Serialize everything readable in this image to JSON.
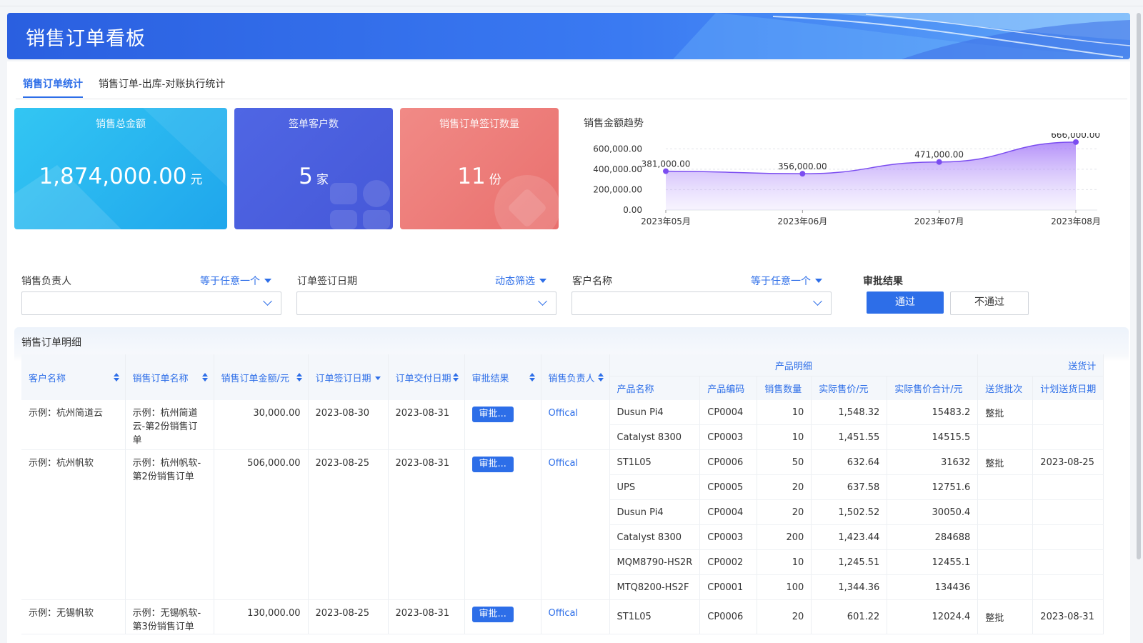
{
  "header": {
    "title": "销售订单看板"
  },
  "tabs": [
    {
      "label": "销售订单统计",
      "active": true
    },
    {
      "label": "销售订单-出库-对账执行统计",
      "active": false
    }
  ],
  "kpis": [
    {
      "label": "销售总金额",
      "value": "1,874,000.00",
      "unit": "元",
      "color": "#2bb6f0"
    },
    {
      "label": "签单客户数",
      "value": "5",
      "unit": "家",
      "color": "#4b5fe0"
    },
    {
      "label": "销售订单签订数量",
      "value": "11",
      "unit": "份",
      "color": "#ef7b78"
    }
  ],
  "chart_title": "销售金额趋势",
  "chart_data": {
    "type": "area",
    "categories": [
      "2023年05月",
      "2023年06月",
      "2023年07月",
      "2023年08月"
    ],
    "values": [
      381000,
      356000,
      471000,
      666000
    ],
    "value_labels": [
      "381,000.00",
      "356,000.00",
      "471,000.00",
      "666,000.00"
    ],
    "y_ticks": [
      "0.00",
      "200,000.00",
      "400,000.00",
      "600,000.00"
    ],
    "y_tick_values": [
      0,
      200000,
      400000,
      600000
    ],
    "ylim": [
      0,
      700000
    ],
    "grid": true,
    "color": "#7b4df0"
  },
  "filters": [
    {
      "label": "销售负责人",
      "mode": "等于任意一个"
    },
    {
      "label": "订单签订日期",
      "mode": "动态筛选"
    },
    {
      "label": "客户名称",
      "mode": "等于任意一个"
    }
  ],
  "approval": {
    "label": "审批结果",
    "pass": "通过",
    "fail": "不通过"
  },
  "detail": {
    "title": "销售订单明细",
    "group_product": "产品明细",
    "group_delivery": "送货计",
    "columns": [
      "客户名称",
      "销售订单名称",
      "销售订单金额/元",
      "订单签订日期",
      "订单交付日期",
      "审批结果",
      "销售负责人",
      "产品名称",
      "产品编码",
      "销售数量",
      "实际售价/元",
      "实际售价合计/元",
      "送货批次",
      "计划送货日期"
    ],
    "orders": [
      {
        "customer": "示例：杭州简道云",
        "order": "示例：杭州简道云-第2份销售订单",
        "amount": "30,000.00",
        "sign": "2023-08-30",
        "deliver": "2023-08-31",
        "approval": "审批...",
        "owner": "Offical",
        "products": [
          {
            "name": "Dusun Pi4",
            "code": "CP0004",
            "qty": "10",
            "price": "1,548.32",
            "total": "15483.2",
            "batch": "整批",
            "plan": ""
          },
          {
            "name": "Catalyst 8300",
            "code": "CP0003",
            "qty": "10",
            "price": "1,451.55",
            "total": "14515.5",
            "batch": "",
            "plan": ""
          }
        ]
      },
      {
        "customer": "示例：杭州帆软",
        "order": "示例：杭州帆软-第2份销售订单",
        "amount": "506,000.00",
        "sign": "2023-08-25",
        "deliver": "2023-08-31",
        "approval": "审批...",
        "owner": "Offical",
        "products": [
          {
            "name": "ST1L05",
            "code": "CP0006",
            "qty": "50",
            "price": "632.64",
            "total": "31632",
            "batch": "整批",
            "plan": "2023-08-25"
          },
          {
            "name": "UPS",
            "code": "CP0005",
            "qty": "20",
            "price": "637.58",
            "total": "12751.6",
            "batch": "",
            "plan": ""
          },
          {
            "name": "Dusun Pi4",
            "code": "CP0004",
            "qty": "20",
            "price": "1,502.52",
            "total": "30050.4",
            "batch": "",
            "plan": ""
          },
          {
            "name": "Catalyst 8300",
            "code": "CP0003",
            "qty": "200",
            "price": "1,423.44",
            "total": "284688",
            "batch": "",
            "plan": ""
          },
          {
            "name": "MQM8790-HS2R",
            "code": "CP0002",
            "qty": "10",
            "price": "1,245.51",
            "total": "12455.1",
            "batch": "",
            "plan": ""
          },
          {
            "name": "MTQ8200-HS2F",
            "code": "CP0001",
            "qty": "100",
            "price": "1,344.36",
            "total": "134436",
            "batch": "",
            "plan": ""
          }
        ]
      },
      {
        "customer": "示例：无锡帆软",
        "order": "示例：无锡帆软-第3份销售订单",
        "amount": "130,000.00",
        "sign": "2023-08-25",
        "deliver": "2023-08-31",
        "approval": "审批...",
        "owner": "Offical",
        "products": [
          {
            "name": "ST1L05",
            "code": "CP0006",
            "qty": "20",
            "price": "601.22",
            "total": "12024.4",
            "batch": "整批",
            "plan": "2023-08-31"
          }
        ]
      }
    ]
  }
}
